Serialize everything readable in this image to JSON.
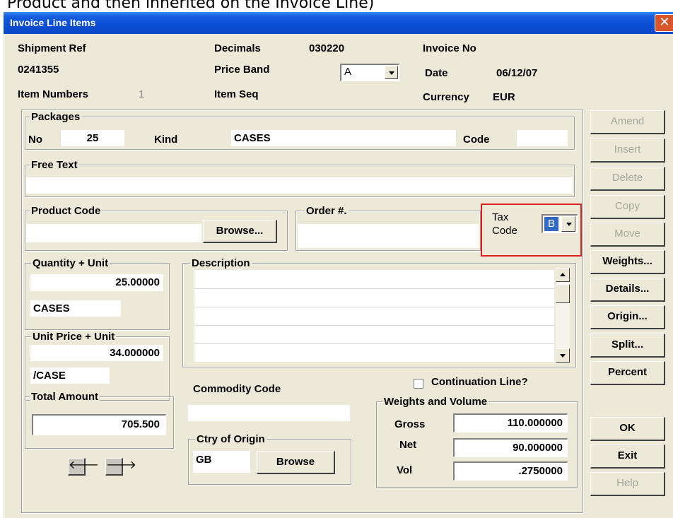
{
  "caption": "Product and then inherited on the Invoice Line)",
  "window": {
    "title": "Invoice Line Items",
    "close_glyph": "✕"
  },
  "header": {
    "shipment_ref_label": "Shipment Ref",
    "shipment_ref_value": "0241355",
    "item_numbers_label": "Item Numbers",
    "item_numbers_value": "1",
    "decimals_label": "Decimals",
    "decimals_value": "030220",
    "price_band_label": "Price Band",
    "price_band_value": "A",
    "item_seq_label": "Item Seq",
    "invoice_no_label": "Invoice No",
    "date_label": "Date",
    "date_value": "06/12/07",
    "currency_label": "Currency",
    "currency_value": "EUR"
  },
  "packages": {
    "group_label": "Packages",
    "no_label": "No",
    "no_value": "25",
    "kind_label": "Kind",
    "kind_value": "CASES",
    "code_label": "Code",
    "code_value": ""
  },
  "free_text": {
    "group_label": "Free Text",
    "value": ""
  },
  "product_code": {
    "group_label": "Product Code",
    "value": "",
    "browse_label": "Browse..."
  },
  "order": {
    "group_label": "Order #.",
    "value": ""
  },
  "tax_code": {
    "label_line1": "Tax",
    "label_line2": "Code",
    "value": "B",
    "highlight_color": "#e02020"
  },
  "quantity": {
    "group_label": "Quantity + Unit",
    "value": "25.00000",
    "unit": "CASES"
  },
  "unit_price": {
    "group_label": "Unit Price + Unit",
    "value": "34.000000",
    "unit": "/CASE"
  },
  "total_amount": {
    "group_label": "Total Amount",
    "value": "705.500"
  },
  "description": {
    "group_label": "Description",
    "lines": [
      "",
      "",
      "",
      "",
      ""
    ]
  },
  "commodity_code": {
    "label": "Commodity Code",
    "value": ""
  },
  "country_of_origin": {
    "group_label": "Ctry of Origin",
    "value": "GB",
    "browse_label": "Browse"
  },
  "continuation_line": {
    "label": "Continuation Line?",
    "checked": false
  },
  "weights_volume": {
    "group_label": "Weights and Volume",
    "gross_label": "Gross",
    "gross_value": "110.000000",
    "net_label": "Net",
    "net_value": "90.000000",
    "vol_label": "Vol",
    "vol_value": ".2750000"
  },
  "nav": {
    "prev_glyph": "🡐",
    "next_glyph": "🡒"
  },
  "side_buttons": {
    "amend": "Amend",
    "insert": "Insert",
    "delete": "Delete",
    "copy": "Copy",
    "move": "Move",
    "weights": "Weights...",
    "details": "Details...",
    "origin": "Origin...",
    "split": "Split...",
    "percent": "Percent",
    "ok": "OK",
    "exit": "Exit",
    "help": "Help"
  },
  "colors": {
    "window_bg": "#ECE9D8",
    "titlebar": "#0a4fd6",
    "close": "#d8552e",
    "selection": "#316ac5"
  }
}
